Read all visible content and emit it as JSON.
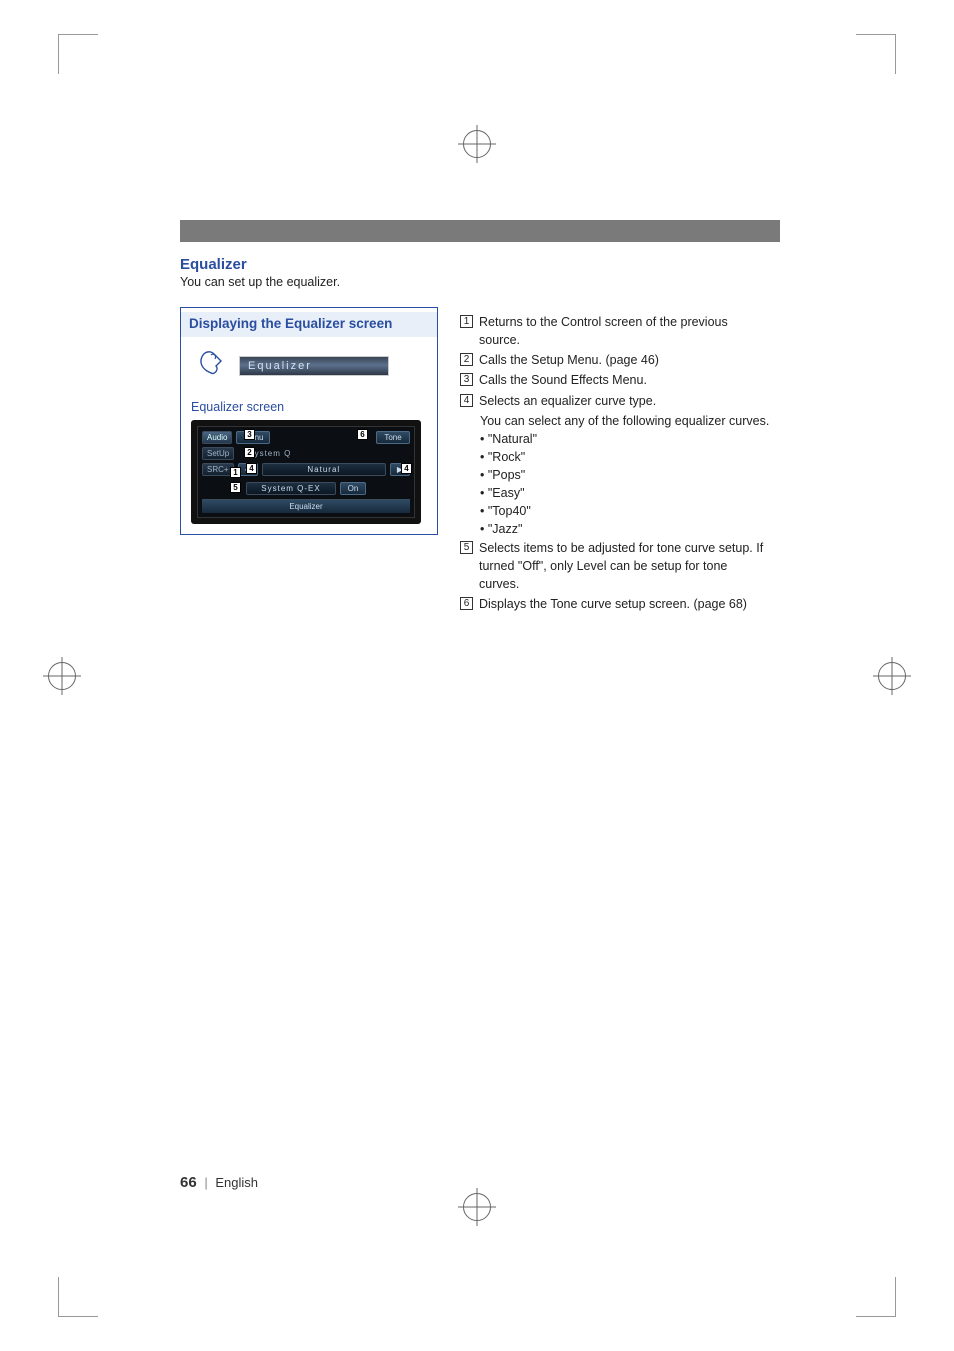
{
  "section": {
    "title": "Equalizer",
    "subtitle": "You can set up the equalizer."
  },
  "box": {
    "heading": "Displaying the Equalizer screen",
    "pill_label": "Equalizer",
    "caption": "Equalizer screen"
  },
  "device": {
    "tabs": {
      "audio": "Audio",
      "setup": "SetUp",
      "src": "SRC+"
    },
    "menu_btn": "Menu",
    "tone_btn": "Tone",
    "sysq_label": "System Q",
    "natural": "Natural",
    "sysqex_label": "System Q-EX",
    "sysqex_state": "On",
    "footer": "Equalizer",
    "callouts": {
      "c1": "1",
      "c2": "2",
      "c3": "3",
      "c4l": "4",
      "c4r": "4",
      "c5": "5",
      "c6": "6"
    }
  },
  "descriptions": {
    "d1": {
      "n": "1",
      "t": "Returns to the Control screen of the previous source."
    },
    "d2": {
      "n": "2",
      "t": "Calls the Setup Menu. (page 46)"
    },
    "d3": {
      "n": "3",
      "t": "Calls the Sound Effects Menu."
    },
    "d4": {
      "n": "4",
      "t": "Selects an equalizer curve type.",
      "t2": "You can select any of the following equalizer curves."
    },
    "curves": [
      "• \"Natural\"",
      "• \"Rock\"",
      "• \"Pops\"",
      "• \"Easy\"",
      "• \"Top40\"",
      "• \"Jazz\""
    ],
    "d5": {
      "n": "5",
      "t": "Selects items to be adjusted for tone curve setup. If turned \"Off\", only Level can be setup for tone curves."
    },
    "d6": {
      "n": "6",
      "t": "Displays the Tone curve setup screen. (page 68)"
    }
  },
  "footer": {
    "page": "66",
    "lang": "English"
  }
}
